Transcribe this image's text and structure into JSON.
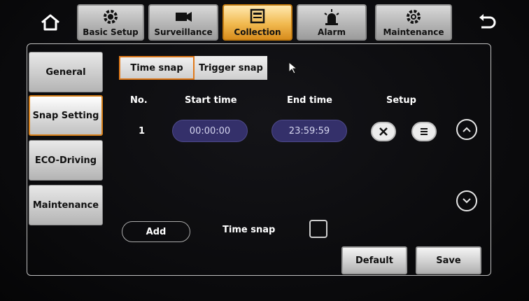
{
  "nav": {
    "tabs": [
      {
        "label": "Basic Setup",
        "icon": "gear-icon"
      },
      {
        "label": "Surveillance",
        "icon": "camera-icon"
      },
      {
        "label": "Collection",
        "icon": "collection-icon"
      },
      {
        "label": "Alarm",
        "icon": "alarm-light-icon"
      },
      {
        "label": "Maintenance",
        "icon": "maintenance-gear-icon"
      }
    ],
    "active_tab": "Collection"
  },
  "sidebar": {
    "items": [
      {
        "label": "General"
      },
      {
        "label": "Snap Setting"
      },
      {
        "label": "ECO-Driving"
      },
      {
        "label": "Maintenance"
      }
    ],
    "active_item": "Snap Setting"
  },
  "subtabs": {
    "items": [
      {
        "label": "Time snap"
      },
      {
        "label": "Trigger snap"
      }
    ],
    "active": "Time snap"
  },
  "table": {
    "headers": [
      "No.",
      "Start time",
      "End time",
      "Setup"
    ],
    "rows": [
      {
        "no": "1",
        "start": "00:00:00",
        "end": "23:59:59"
      }
    ]
  },
  "footer": {
    "add_label": "Add",
    "time_snap_label": "Time snap",
    "time_snap_checked": false,
    "default_label": "Default",
    "save_label": "Save"
  },
  "colors": {
    "active_tab": "#f1b94f",
    "active_border": "#e07a1c",
    "time_pill": "#34306a",
    "background": "#0d0d0f"
  }
}
